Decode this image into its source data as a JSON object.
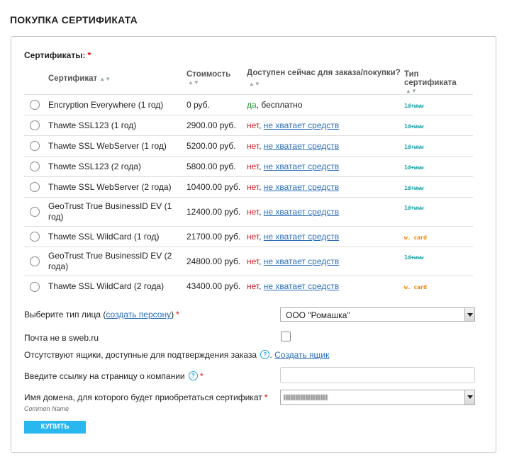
{
  "page": {
    "title": "ПОКУПКА СЕРТИФИКАТА"
  },
  "certificates": {
    "label": "Сертификаты:",
    "required_mark": "*",
    "headers": {
      "name": "Сертификат",
      "price": "Стоимость",
      "available": "Доступен сейчас для заказа/покупки?",
      "type": "Тип сертификата"
    },
    "rows": [
      {
        "name": "Encryption Everywhere (1 год)",
        "price": "0 руб.",
        "status": "да",
        "sep": ", ",
        "note": "бесплатно",
        "type_badge": "1d+www"
      },
      {
        "name": "Thawte SSL123 (1 год)",
        "price": "2900.00 руб.",
        "status": "нет",
        "sep": ", ",
        "note": "не хватает средств",
        "type_badge": "1d+www"
      },
      {
        "name": "Thawte SSL WebServer (1 год)",
        "price": "5200.00 руб.",
        "status": "нет",
        "sep": ", ",
        "note": "не хватает средств",
        "type_badge": "1d+www"
      },
      {
        "name": "Thawte SSL123 (2 года)",
        "price": "5800.00 руб.",
        "status": "нет",
        "sep": ", ",
        "note": "не хватает средств",
        "type_badge": "1d+www"
      },
      {
        "name": "Thawte SSL WebServer (2 года)",
        "price": "10400.00 руб.",
        "status": "нет",
        "sep": ", ",
        "note": "не хватает средств",
        "type_badge": "1d+www"
      },
      {
        "name": "GeoTrust True BusinessID EV (1 год)",
        "price": "12400.00 руб.",
        "status": "нет",
        "sep": ", ",
        "note": "не хватает средств",
        "type_badge": "1d+www"
      },
      {
        "name": "Thawte SSL WildCard (1 год)",
        "price": "21700.00 руб.",
        "status": "нет",
        "sep": ", ",
        "note": "не хватает средств",
        "type_badge": "w. card"
      },
      {
        "name": "GeoTrust True BusinessID EV (2 года)",
        "price": "24800.00 руб.",
        "status": "нет",
        "sep": ", ",
        "note": "не хватает средств",
        "type_badge": "1d+www"
      },
      {
        "name": "Thawte SSL WildCard (2 года)",
        "price": "43400.00 руб.",
        "status": "нет",
        "sep": ", ",
        "note": "не хватает средств",
        "type_badge": "w. card"
      }
    ]
  },
  "form": {
    "person": {
      "label_before": "Выберите тип лица (",
      "link": "создать персону",
      "label_after": ")",
      "required_mark": "*",
      "selected": "ООО \"Ромашка\""
    },
    "mail": {
      "label": "Почта не в sweb.ru"
    },
    "mailbox": {
      "label": "Отсутствуют ящики, доступные для подтверждения заказа",
      "help": "?",
      "sep": ".",
      "link": "Создать ящик"
    },
    "company_link": {
      "label": "Введите ссылку на страницу о компании",
      "help": "?",
      "required_mark": "*",
      "value": ""
    },
    "domain": {
      "label": "Имя домена, для которого будет приобретаться сертификат",
      "required_mark": "*",
      "hint": "Common Name"
    },
    "buy_button": "КУПИТЬ"
  },
  "colors": {
    "accent": "#29b7ef",
    "yes": "#2a9a3a",
    "no": "#d0202c",
    "link": "#2a6ebb",
    "badge_teal": "#18a2a8",
    "badge_orange": "#f08000"
  }
}
